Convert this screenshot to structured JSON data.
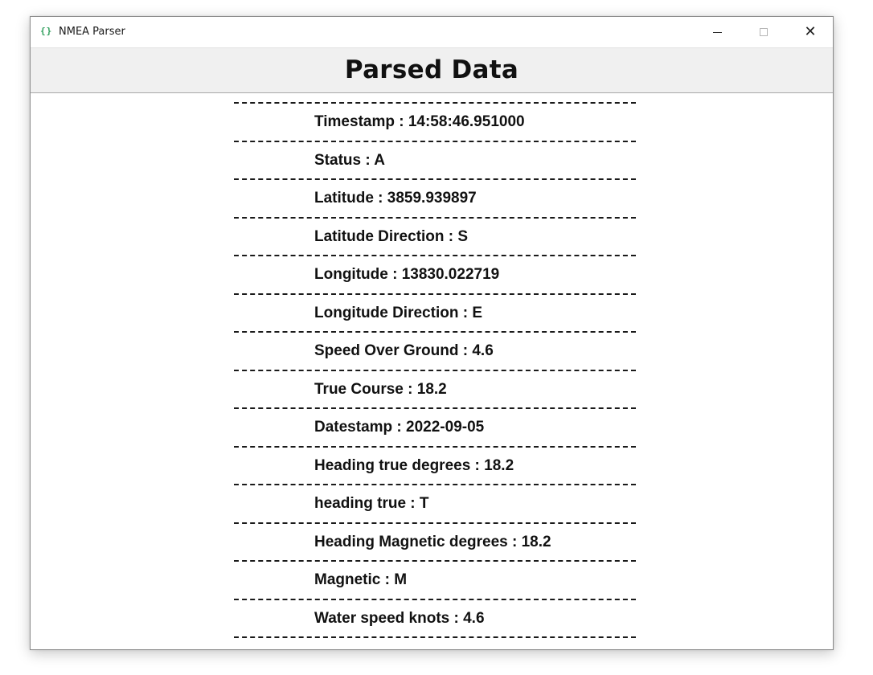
{
  "window": {
    "title": "NMEA Parser",
    "icon": "braces-icon",
    "controls": {
      "minimize": "minimize-icon",
      "maximize": "maximize-icon",
      "close": "close-icon"
    }
  },
  "header": {
    "title": "Parsed Data"
  },
  "fields": [
    {
      "label": "Timestamp",
      "value": "14:58:46.951000",
      "text": "Timestamp : 14:58:46.951000"
    },
    {
      "label": "Status",
      "value": "A",
      "text": "Status : A"
    },
    {
      "label": "Latitude",
      "value": "3859.939897",
      "text": "Latitude : 3859.939897"
    },
    {
      "label": "Latitude Direction",
      "value": "S",
      "text": "Latitude Direction : S"
    },
    {
      "label": "Longitude",
      "value": "13830.022719",
      "text": "Longitude : 13830.022719"
    },
    {
      "label": "Longitude Direction",
      "value": "E",
      "text": "Longitude Direction : E"
    },
    {
      "label": "Speed Over Ground",
      "value": "4.6",
      "text": "Speed Over Ground : 4.6"
    },
    {
      "label": "True Course",
      "value": "18.2",
      "text": "True Course : 18.2"
    },
    {
      "label": "Datestamp",
      "value": "2022-09-05",
      "text": "Datestamp : 2022-09-05"
    },
    {
      "label": "Heading true degrees",
      "value": "18.2",
      "text": "Heading true degrees : 18.2"
    },
    {
      "label": "heading true",
      "value": "T",
      "text": "heading true : T"
    },
    {
      "label": "Heading Magnetic degrees",
      "value": "18.2",
      "text": "Heading Magnetic degrees : 18.2"
    },
    {
      "label": "Magnetic",
      "value": "M",
      "text": "Magnetic : M"
    },
    {
      "label": "Water speed knots",
      "value": "4.6",
      "text": "Water speed knots : 4.6"
    }
  ],
  "colors": {
    "header_bg": "#f0f0f0",
    "text": "#111111",
    "app_icon": "#2e9e5b"
  }
}
